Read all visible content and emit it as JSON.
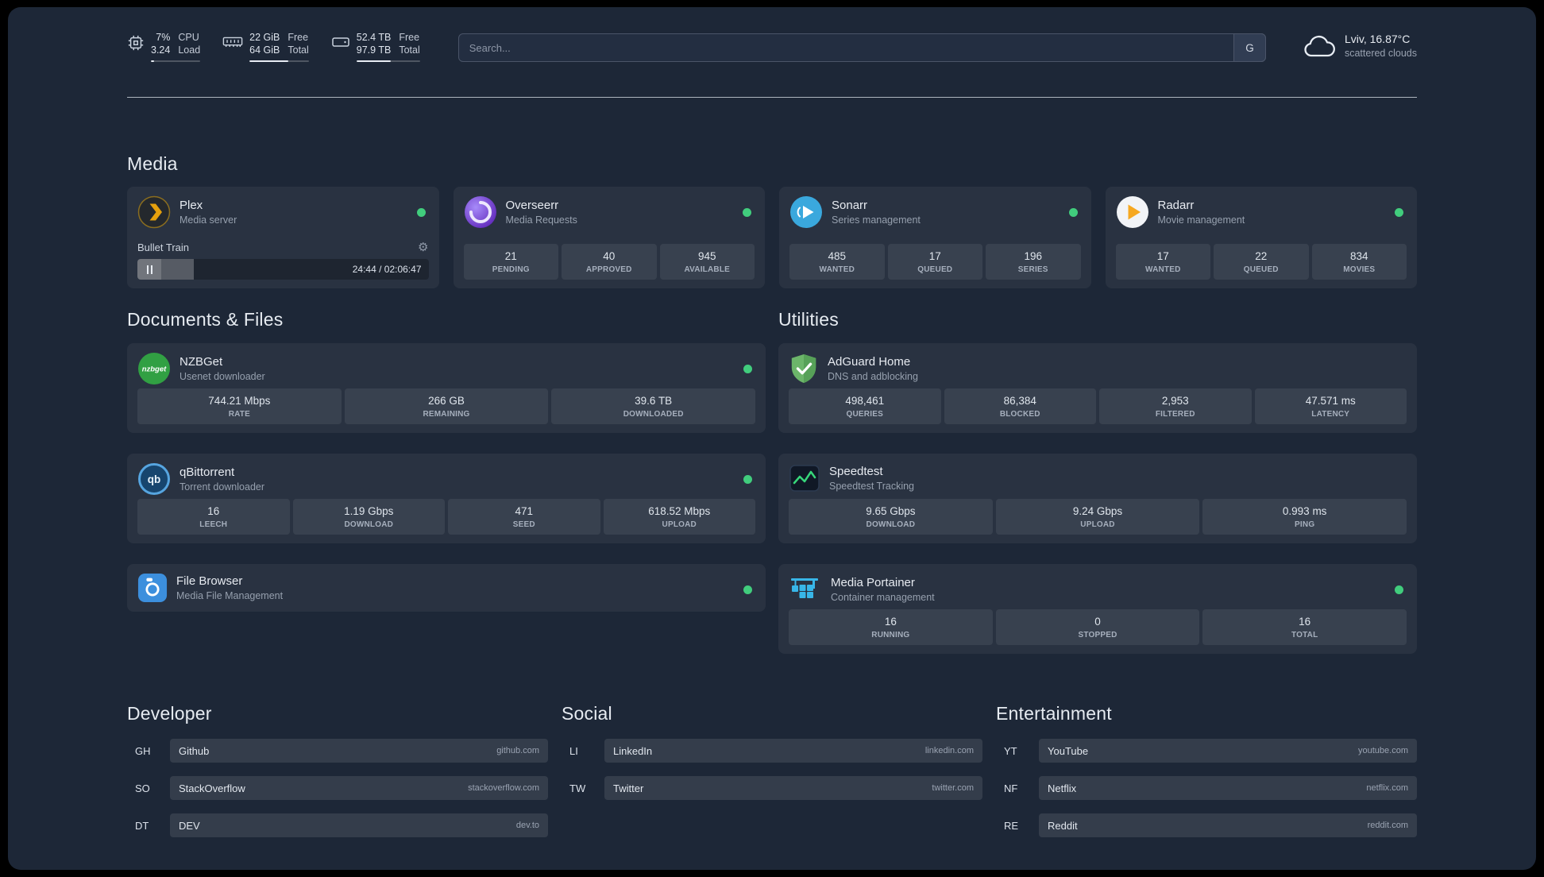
{
  "topbar": {
    "cpu": {
      "value1": "7%",
      "value2": "3.24",
      "label1": "CPU",
      "label2": "Load",
      "bar_percent": 7
    },
    "memory": {
      "value1": "22 GiB",
      "value2": "64 GiB",
      "label1": "Free",
      "label2": "Total",
      "bar_percent": 66
    },
    "disk": {
      "value1": "52.4 TB",
      "value2": "97.9 TB",
      "label1": "Free",
      "label2": "Total",
      "bar_percent": 54
    },
    "search": {
      "placeholder": "Search...",
      "provider_label": "G"
    },
    "weather": {
      "location": "Lviv, 16.87°C",
      "condition": "scattered clouds"
    }
  },
  "media": {
    "title": "Media",
    "plex": {
      "name": "Plex",
      "subtitle": "Media server",
      "player_title": "Bullet Train",
      "player_time": "24:44 / 02:06:47",
      "progress_percent": 19.5
    },
    "overseerr": {
      "name": "Overseerr",
      "subtitle": "Media Requests",
      "stats": [
        {
          "value": "21",
          "label": "PENDING"
        },
        {
          "value": "40",
          "label": "APPROVED"
        },
        {
          "value": "945",
          "label": "AVAILABLE"
        }
      ]
    },
    "sonarr": {
      "name": "Sonarr",
      "subtitle": "Series management",
      "stats": [
        {
          "value": "485",
          "label": "WANTED"
        },
        {
          "value": "17",
          "label": "QUEUED"
        },
        {
          "value": "196",
          "label": "SERIES"
        }
      ]
    },
    "radarr": {
      "name": "Radarr",
      "subtitle": "Movie management",
      "stats": [
        {
          "value": "17",
          "label": "WANTED"
        },
        {
          "value": "22",
          "label": "QUEUED"
        },
        {
          "value": "834",
          "label": "MOVIES"
        }
      ]
    }
  },
  "documents": {
    "title": "Documents & Files",
    "nzbget": {
      "name": "NZBGet",
      "subtitle": "Usenet downloader",
      "stats": [
        {
          "value": "744.21 Mbps",
          "label": "RATE"
        },
        {
          "value": "266 GB",
          "label": "REMAINING"
        },
        {
          "value": "39.6 TB",
          "label": "DOWNLOADED"
        }
      ]
    },
    "qbittorrent": {
      "name": "qBittorrent",
      "subtitle": "Torrent downloader",
      "stats": [
        {
          "value": "16",
          "label": "LEECH"
        },
        {
          "value": "1.19 Gbps",
          "label": "DOWNLOAD"
        },
        {
          "value": "471",
          "label": "SEED"
        },
        {
          "value": "618.52 Mbps",
          "label": "UPLOAD"
        }
      ]
    },
    "filebrowser": {
      "name": "File Browser",
      "subtitle": "Media File Management"
    }
  },
  "utilities": {
    "title": "Utilities",
    "adguard": {
      "name": "AdGuard Home",
      "subtitle": "DNS and adblocking",
      "stats": [
        {
          "value": "498,461",
          "label": "QUERIES"
        },
        {
          "value": "86,384",
          "label": "BLOCKED"
        },
        {
          "value": "2,953",
          "label": "FILTERED"
        },
        {
          "value": "47.571 ms",
          "label": "LATENCY"
        }
      ]
    },
    "speedtest": {
      "name": "Speedtest",
      "subtitle": "Speedtest Tracking",
      "stats": [
        {
          "value": "9.65 Gbps",
          "label": "DOWNLOAD"
        },
        {
          "value": "9.24 Gbps",
          "label": "UPLOAD"
        },
        {
          "value": "0.993 ms",
          "label": "PING"
        }
      ]
    },
    "portainer": {
      "name": "Media Portainer",
      "subtitle": "Container management",
      "stats": [
        {
          "value": "16",
          "label": "RUNNING"
        },
        {
          "value": "0",
          "label": "STOPPED"
        },
        {
          "value": "16",
          "label": "TOTAL"
        }
      ]
    }
  },
  "bookmarks": {
    "developer": {
      "title": "Developer",
      "items": [
        {
          "abbr": "GH",
          "name": "Github",
          "url": "github.com"
        },
        {
          "abbr": "SO",
          "name": "StackOverflow",
          "url": "stackoverflow.com"
        },
        {
          "abbr": "DT",
          "name": "DEV",
          "url": "dev.to"
        }
      ]
    },
    "social": {
      "title": "Social",
      "items": [
        {
          "abbr": "LI",
          "name": "LinkedIn",
          "url": "linkedin.com"
        },
        {
          "abbr": "TW",
          "name": "Twitter",
          "url": "twitter.com"
        }
      ]
    },
    "entertainment": {
      "title": "Entertainment",
      "items": [
        {
          "abbr": "YT",
          "name": "YouTube",
          "url": "youtube.com"
        },
        {
          "abbr": "NF",
          "name": "Netflix",
          "url": "netflix.com"
        },
        {
          "abbr": "RE",
          "name": "Reddit",
          "url": "reddit.com"
        }
      ]
    }
  },
  "colors": {
    "status_online": "#41cd7d",
    "plex_gold": "#e5a00d",
    "adguard_green": "#62ae60",
    "speedtest_green": "#37d67a",
    "portainer_blue": "#38b6e8"
  },
  "icons": {
    "topbar": [
      "cpu-icon",
      "memory-icon",
      "disk-icon",
      "cloud-icon"
    ],
    "services": [
      "plex-icon",
      "overseerr-icon",
      "sonarr-icon",
      "radarr-icon",
      "nzbget-icon",
      "qbittorrent-icon",
      "filebrowser-icon",
      "adguard-icon",
      "speedtest-icon",
      "portainer-icon"
    ],
    "misc": [
      "gear-icon",
      "pause-icon"
    ]
  }
}
